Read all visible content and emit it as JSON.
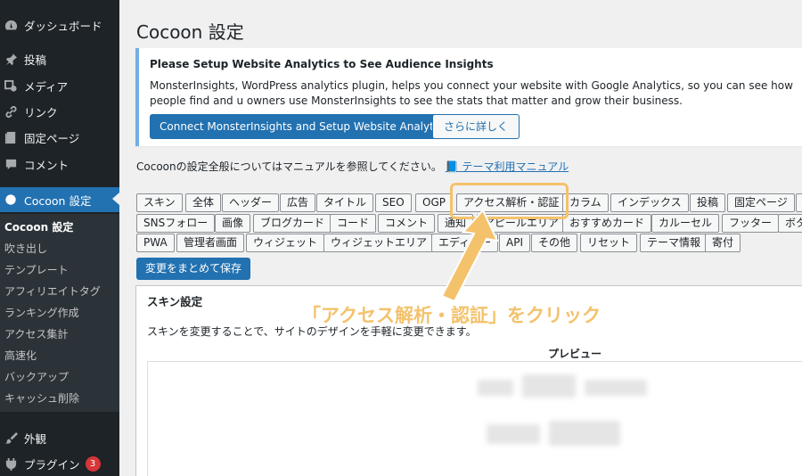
{
  "sidebar": {
    "top_items": [
      {
        "label": "ダッシュボード",
        "icon": "dashboard-icon"
      },
      {
        "label": "投稿",
        "icon": "pushpin-icon"
      },
      {
        "label": "メディア",
        "icon": "media-icon"
      },
      {
        "label": "リンク",
        "icon": "link-icon"
      },
      {
        "label": "固定ページ",
        "icon": "page-icon"
      },
      {
        "label": "コメント",
        "icon": "comment-icon"
      }
    ],
    "active_item": {
      "label": "Cocoon 設定",
      "icon": "cocoon-icon"
    },
    "submenu": [
      "Cocoon 設定",
      "吹き出し",
      "テンプレート",
      "アフィリエイトタグ",
      "ランキング作成",
      "アクセス集計",
      "高速化",
      "バックアップ",
      "キャッシュ削除"
    ],
    "bottom_items": [
      {
        "label": "外観",
        "icon": "brush-icon"
      },
      {
        "label": "プラグイン",
        "icon": "plugin-icon",
        "badge": "3"
      }
    ]
  },
  "main": {
    "title": "Cocoon 設定",
    "notice": {
      "title": "Please Setup Website Analytics to See Audience Insights",
      "text": "MonsterInsights, WordPress analytics plugin, helps you connect your website with Google Analytics, so you can see how people find and u owners use MonsterInsights to see the stats that matter and grow their business.",
      "connect_button": "Connect MonsterInsights and Setup Website Analytics",
      "more_button": "さらに詳しく"
    },
    "manual_text": "Cocoonの設定全般についてはマニュアルを参照してください。",
    "manual_link": "テーマ利用マニュアル",
    "tabs_row1": [
      "スキン",
      "全体",
      "ヘッダー",
      "広告",
      "タイトル",
      "SEO",
      "OGP",
      "アクセス解析・認証",
      "カラム",
      "インデックス",
      "投稿",
      "固定ページ"
    ],
    "tabs_row2": [
      "SNSフォロー",
      "画像",
      "ブログカード",
      "コード",
      "コメント",
      "通知",
      "アピールエリア",
      "おすすめカード",
      "カルーセル",
      "フッター",
      "ボタン"
    ],
    "tabs_row3": [
      "PWA",
      "管理者画面",
      "ウィジェット",
      "ウィジェットエリア",
      "エディター",
      "API",
      "その他",
      "リセット",
      "テーマ情報",
      "寄付"
    ],
    "save_button": "変更をまとめて保存",
    "panel": {
      "title": "スキン設定",
      "description": "スキンを変更することで、サイトのデザインを手軽に変更できます。",
      "preview_label": "プレビュー"
    }
  },
  "annotation": {
    "text": "「アクセス解析・認証」をクリック",
    "color": "#f4c26b"
  },
  "colors": {
    "accent": "#2271b1",
    "sidebar_bg": "#1d2327",
    "badge": "#d63638"
  }
}
